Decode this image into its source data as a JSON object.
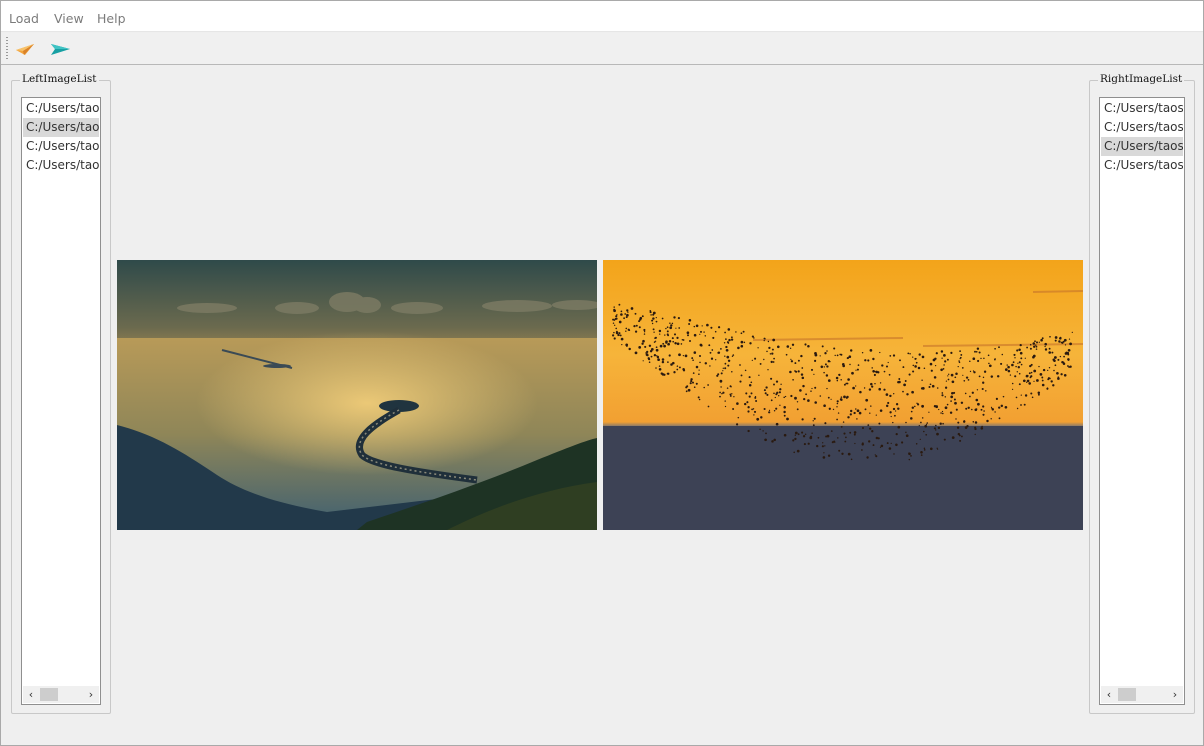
{
  "menubar": {
    "items": [
      "Load",
      "View",
      "Help"
    ]
  },
  "toolbar": {
    "buttons": [
      {
        "icon": "paper-plane-orange-icon",
        "color": "#f0a030"
      },
      {
        "icon": "paper-plane-teal-icon",
        "color": "#1ba4a6"
      }
    ]
  },
  "left_panel": {
    "title": "LeftImageList",
    "items": [
      {
        "label": "C:/Users/taos",
        "selected": false
      },
      {
        "label": "C:/Users/taos",
        "selected": true
      },
      {
        "label": "C:/Users/taos",
        "selected": false
      },
      {
        "label": "C:/Users/taos",
        "selected": false
      }
    ]
  },
  "right_panel": {
    "title": "RightImageList",
    "items": [
      {
        "label": "C:/Users/taos",
        "selected": false
      },
      {
        "label": "C:/Users/taos",
        "selected": false
      },
      {
        "label": "C:/Users/taos",
        "selected": true
      },
      {
        "label": "C:/Users/taos",
        "selected": false
      }
    ]
  },
  "images": {
    "left": {
      "subject": "sea-bridge-sunset"
    },
    "right": {
      "subject": "bird-flock-sunset"
    }
  },
  "colors": {
    "selection": "#d9d9d9",
    "window_bg": "#efefef"
  }
}
